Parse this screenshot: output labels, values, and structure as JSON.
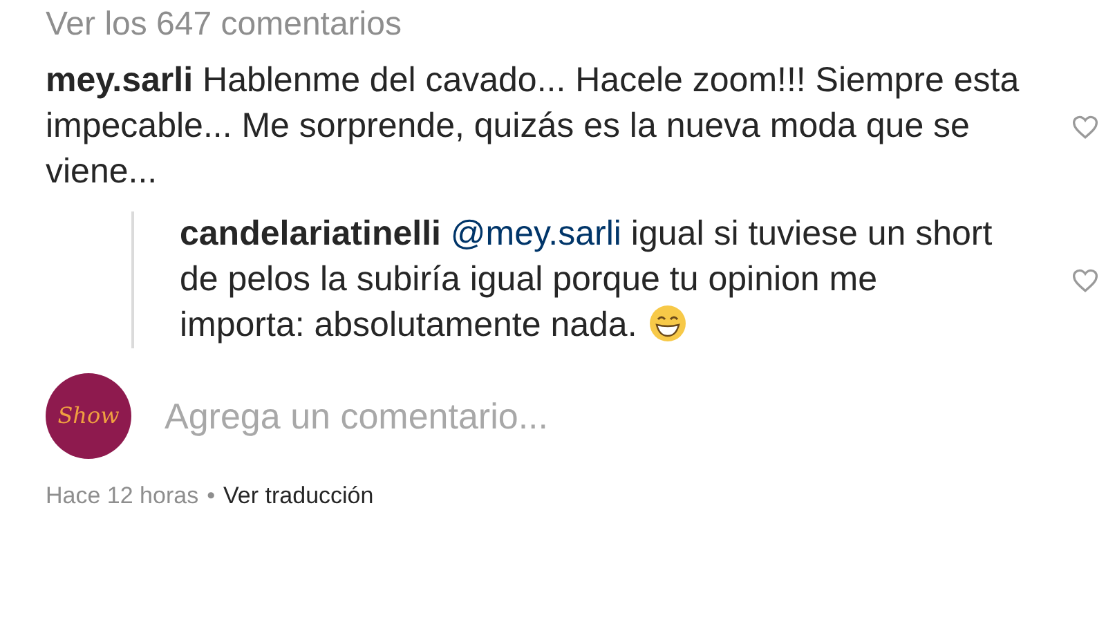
{
  "view_all": "Ver los 647 comentarios",
  "comments": [
    {
      "username": "mey.sarli",
      "text": "Hablenme del cavado... Hacele zoom!!! Siempre esta impecable... Me sorprende, quizás es la nueva moda que se viene...",
      "liked": false,
      "replies": [
        {
          "username": "candelariatinelli",
          "mention": "@mey.sarli",
          "text": "igual si tuviese un short de pelos la subiría igual porque tu opinion me importa: absolutamente nada.",
          "liked": false
        }
      ]
    }
  ],
  "add_comment": {
    "avatar_text": "Show",
    "placeholder": "Agrega un comentario..."
  },
  "footer": {
    "time": "Hace 12 horas",
    "separator": "•",
    "translate": "Ver traducción"
  }
}
